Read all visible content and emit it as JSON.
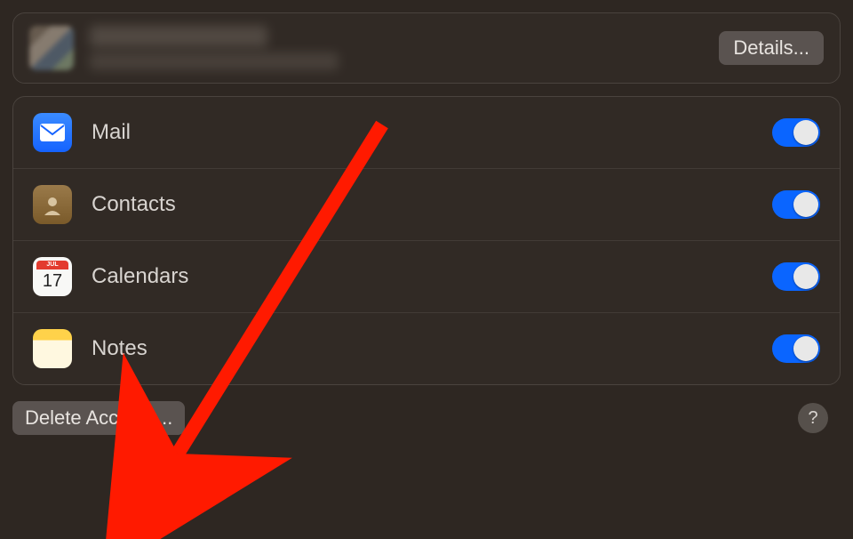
{
  "account": {
    "name_redacted": true,
    "email_redacted": true,
    "details_button": "Details..."
  },
  "services": [
    {
      "id": "mail",
      "label": "Mail",
      "enabled": true,
      "icon": "mail-icon"
    },
    {
      "id": "contacts",
      "label": "Contacts",
      "enabled": true,
      "icon": "contacts-icon"
    },
    {
      "id": "calendar",
      "label": "Calendars",
      "enabled": true,
      "icon": "calendar-icon",
      "calendar_month": "JUL",
      "calendar_day": "17"
    },
    {
      "id": "notes",
      "label": "Notes",
      "enabled": true,
      "icon": "notes-icon"
    }
  ],
  "footer": {
    "delete_button": "Delete Account...",
    "help_label": "?"
  },
  "annotation": {
    "arrow_color": "#ff1a00"
  }
}
